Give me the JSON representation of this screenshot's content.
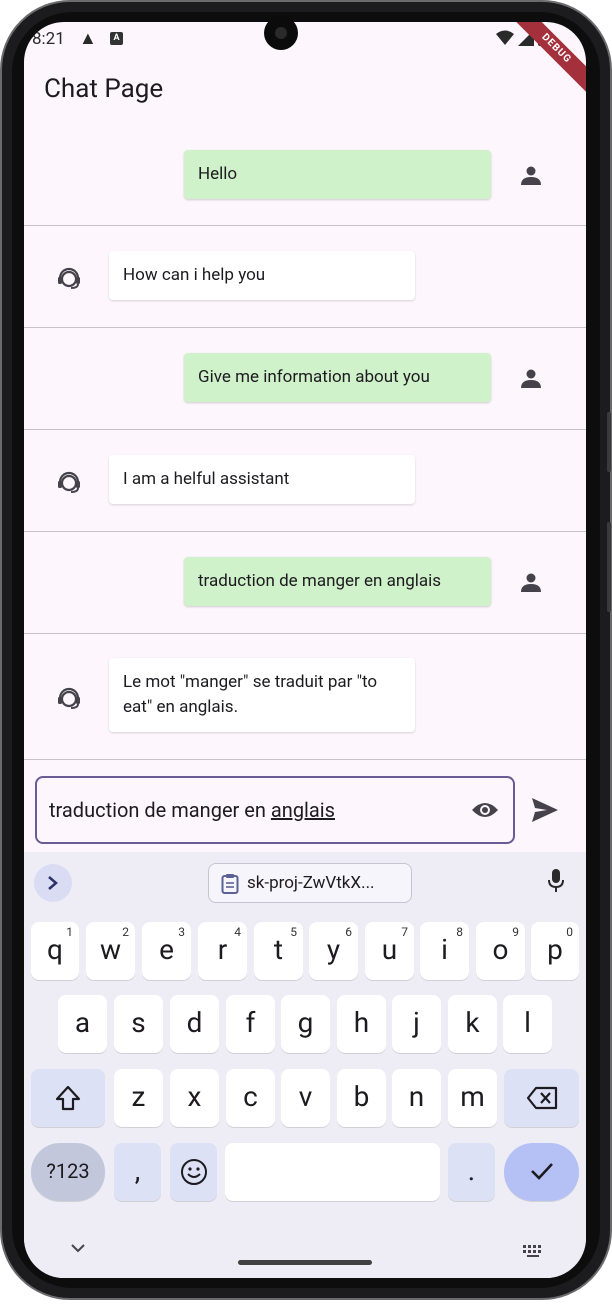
{
  "status_bar": {
    "time": "8:21",
    "debug_label": "DEBUG"
  },
  "app_bar": {
    "title": "Chat Page"
  },
  "messages": [
    {
      "role": "user",
      "text": "Hello"
    },
    {
      "role": "bot",
      "text": "How can i help you"
    },
    {
      "role": "user",
      "text": "Give me information about you"
    },
    {
      "role": "bot",
      "text": "I am a helful assistant"
    },
    {
      "role": "user",
      "text": "traduction de manger en anglais"
    },
    {
      "role": "bot",
      "text": "Le mot \"manger\" se traduit par \"to eat\" en anglais."
    }
  ],
  "input": {
    "value_prefix": "traduction de manger en ",
    "value_underlined": "anglais"
  },
  "keyboard": {
    "clipboard_chip": "sk-proj-ZwVtkX...",
    "row1": [
      "q",
      "w",
      "e",
      "r",
      "t",
      "y",
      "u",
      "i",
      "o",
      "p"
    ],
    "row1_sup": [
      "1",
      "2",
      "3",
      "4",
      "5",
      "6",
      "7",
      "8",
      "9",
      "0"
    ],
    "row2": [
      "a",
      "s",
      "d",
      "f",
      "g",
      "h",
      "j",
      "k",
      "l"
    ],
    "row3": [
      "z",
      "x",
      "c",
      "v",
      "b",
      "n",
      "m"
    ],
    "symbols_key": "?123",
    "comma_key": ",",
    "period_key": "."
  },
  "colors": {
    "user_bubble": "#d0f2ca",
    "bot_bubble": "#ffffff",
    "accent": "#6c5b94",
    "background": "#fdf7fd"
  }
}
